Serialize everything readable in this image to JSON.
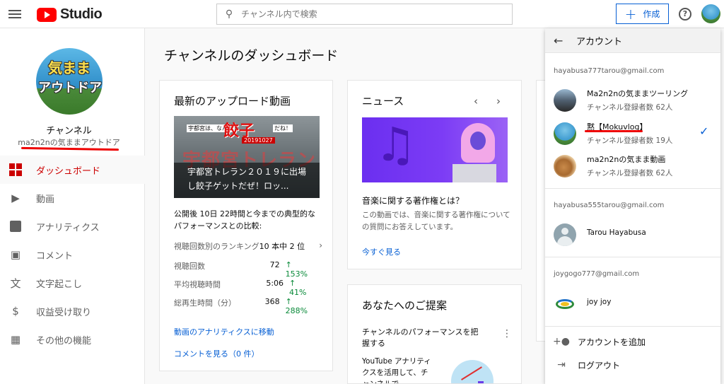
{
  "header": {
    "logo_text": "Studio",
    "search_placeholder": "チャンネル内で検索",
    "create_label": "作成",
    "help_glyph": "?"
  },
  "sidebar": {
    "avatar_line1": "気まま",
    "avatar_line2": "アウトドア",
    "channel_label": "チャンネル",
    "channel_name": "ma2n2nの気ままアウトドア",
    "items": [
      {
        "label": "ダッシュボード",
        "icon": "dashboard-icon",
        "active": true
      },
      {
        "label": "動画",
        "icon": "video-icon",
        "active": false
      },
      {
        "label": "アナリティクス",
        "icon": "analytics-icon",
        "active": false
      },
      {
        "label": "コメント",
        "icon": "comment-icon",
        "active": false
      },
      {
        "label": "文字起こし",
        "icon": "subtitles-icon",
        "active": false
      },
      {
        "label": "収益受け取り",
        "icon": "dollar-icon",
        "active": false
      },
      {
        "label": "その他の機能",
        "icon": "other-features-icon",
        "active": false
      }
    ]
  },
  "main": {
    "title": "チャンネルのダッシュボード",
    "upload_card": {
      "title": "最新のアップロード動画",
      "thumb_tag_left": "宇都宮ほ、なんと",
      "thumb_big": "餃子",
      "thumb_tag_right": "だね！",
      "thumb_date": "20191027",
      "thumb_bg_text": "宇都宮トレラン",
      "video_title": "宇都宮トレラン２０１９に出場し餃子ゲットだぜ！ロッ...",
      "description": "公開後 10日 22時間と今までの典型的なパフォーマンスとの比較:",
      "ranking_label": "視聴回数別のランキング",
      "ranking_value": "10 本中 2 位",
      "stats": [
        {
          "label": "視聴回数",
          "value": "72",
          "delta": "153%"
        },
        {
          "label": "平均視聴時間",
          "value": "5:06",
          "delta": "41%"
        },
        {
          "label": "総再生時間（分）",
          "value": "368",
          "delta": "288%"
        }
      ],
      "analytics_link": "動画のアナリティクスに移動",
      "comments_link": "コメントを見る（0 件）"
    },
    "news_card": {
      "title": "ニュース",
      "headline": "音楽に関する著作権とは？",
      "text": "この動画では、音楽に関する著作権についての質問にお答えしています。",
      "watch_link": "今すぐ見る"
    },
    "suggest_card": {
      "title": "あなたへのご提案",
      "subtitle": "チャンネルのパフォーマンスを把握する",
      "text": "YouTube アナリティクスを活用して、チャンネルで"
    }
  },
  "account_panel": {
    "title": "アカウント",
    "groups": [
      {
        "email": "hayabusa777tarou@gmail.com",
        "accounts": [
          {
            "name": "Ma2n2nの気ままツーリング",
            "subs": "チャンネル登録者数 62人",
            "selected": false
          },
          {
            "name": "黙【Mokuvlog】",
            "subs": "チャンネル登録者数 19人",
            "selected": true
          },
          {
            "name": "ma2n2nの気まま動画",
            "subs": "チャンネル登録者数 62人",
            "selected": false
          }
        ]
      },
      {
        "email": "hayabusa555tarou@gmail.com",
        "accounts": [
          {
            "name": "Tarou Hayabusa"
          }
        ]
      },
      {
        "email": "joygogo777@gmail.com",
        "accounts": [
          {
            "name": "joy joy"
          }
        ]
      }
    ],
    "actions": [
      {
        "label": "アカウントを追加",
        "icon": "add-person-icon"
      },
      {
        "label": "ログアウト",
        "icon": "logout-icon"
      }
    ]
  },
  "colors": {
    "accent_blue": "#065fd4",
    "active_red": "#cc0000",
    "positive_green": "#0a8a3a",
    "annotation_red": "#ee0000"
  }
}
